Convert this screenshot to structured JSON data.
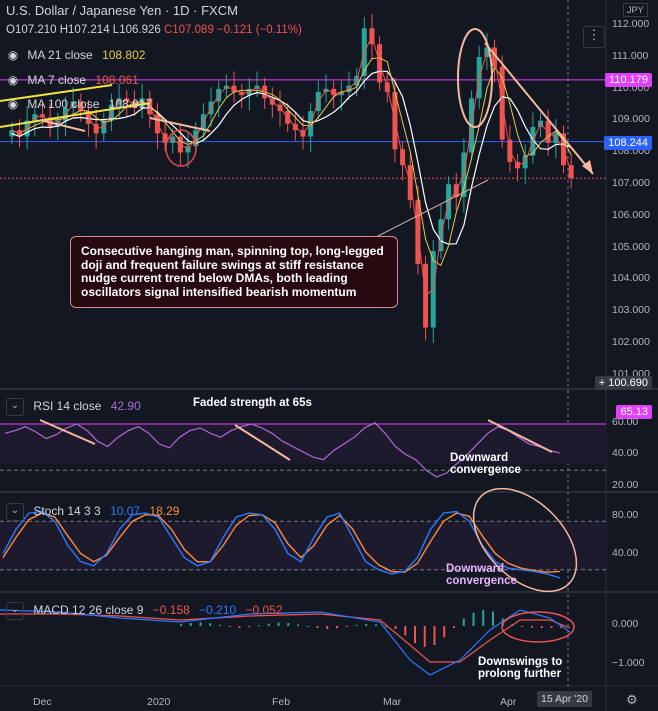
{
  "header": {
    "title": "U.S. Dollar / Japanese Yen · 1D · FXCM",
    "ohlc": {
      "o": "O107.210",
      "h": "H107.214",
      "l": "L106.926",
      "c": "C107.089",
      "chg": "−0.121 (−0.11%)"
    },
    "currency_badge": "JPY",
    "ma21": {
      "label": "MA 21 close",
      "value": "108.802",
      "color": "#e6c84a"
    },
    "ma7": {
      "label": "MA 7 close",
      "value": "108.061",
      "color": "#ef5350"
    },
    "ma100": {
      "label": "MA 100 close",
      "value": "108.917",
      "color": "#ffffff"
    }
  },
  "price_axis": {
    "ticks": [
      "112.000",
      "111.000",
      "110.000",
      "109.000",
      "108.000",
      "107.000",
      "106.000",
      "105.000",
      "104.000",
      "103.000",
      "102.000",
      "101.000"
    ],
    "tag_resistance": "110.179",
    "tag_current": "108.244",
    "tag_low": "100.690"
  },
  "rsi": {
    "label": "RSI 14 close",
    "value": "42.90",
    "tag": "65.13",
    "ticks": [
      "60.00",
      "40.00",
      "20.00"
    ],
    "color": "#b069d6"
  },
  "stoch": {
    "label": "Stoch 14 3 3",
    "k": "10.07",
    "d": "18.29",
    "ticks": [
      "80.00",
      "40.00"
    ],
    "k_color": "#2979ff",
    "d_color": "#ff8a3d"
  },
  "macd": {
    "label": "MACD 12 26 close 9",
    "v1": "−0.158",
    "v2": "−0.210",
    "v3": "−0.052",
    "ticks": [
      "0.000",
      "−1.000"
    ]
  },
  "time_axis": {
    "labels": [
      "Dec",
      "2020",
      "Feb",
      "Mar",
      "Apr"
    ],
    "current": "15 Apr '20"
  },
  "annotations": {
    "main": "Consecutive hanging man, spinning top, long-legged doji and frequent failure swings at stiff resistance nudge current trend below DMAs, both leading oscillators signal intensified bearish momentum",
    "rsi_faded": "Faded strength at 65s",
    "rsi_conv": "Downward convergence",
    "stoch_conv": "Downward convergence",
    "macd_note": "Downswings to prolong further"
  },
  "chart_data": {
    "type": "candlestick",
    "price_ylim": [
      101,
      112
    ],
    "ohlc_close_series": [
      108.6,
      108.4,
      108.9,
      109.1,
      109.0,
      108.7,
      108.9,
      109.3,
      109.5,
      109.2,
      108.8,
      108.5,
      108.9,
      109.4,
      109.6,
      109.5,
      109.3,
      109.6,
      109.1,
      108.5,
      108.2,
      108.4,
      107.9,
      108.1,
      108.6,
      109.1,
      109.5,
      109.9,
      110.0,
      109.8,
      109.7,
      109.9,
      110.0,
      109.6,
      109.4,
      109.2,
      108.8,
      108.6,
      108.4,
      109.2,
      109.8,
      109.9,
      109.7,
      109.8,
      110.0,
      110.3,
      111.8,
      111.3,
      110.1,
      109.8,
      108.0,
      107.5,
      106.4,
      104.4,
      102.4,
      104.8,
      105.8,
      106.9,
      106.5,
      107.9,
      109.6,
      110.9,
      111.2,
      110.6,
      108.3,
      107.6,
      107.4,
      107.8,
      108.7,
      108.9,
      108.2,
      108.5,
      107.5,
      107.1
    ],
    "rsi": [
      58,
      60,
      63,
      59,
      54,
      57,
      62,
      65,
      60,
      52,
      48,
      55,
      60,
      63,
      58,
      50,
      47,
      55,
      60,
      62,
      58,
      55,
      60,
      63,
      65,
      62,
      58,
      52,
      48,
      44,
      40,
      38,
      45,
      50,
      55,
      62,
      66,
      58,
      48,
      42,
      38,
      30,
      25,
      28,
      35,
      42,
      50,
      58,
      63,
      60,
      55,
      50,
      48,
      45,
      43
    ],
    "stoch_k": [
      40,
      70,
      90,
      92,
      80,
      50,
      30,
      25,
      40,
      70,
      88,
      90,
      85,
      60,
      35,
      25,
      30,
      60,
      85,
      90,
      88,
      70,
      40,
      30,
      60,
      85,
      90,
      60,
      30,
      20,
      15,
      18,
      35,
      70,
      90,
      92,
      80,
      50,
      30,
      22,
      20,
      18,
      15,
      10
    ],
    "stoch_d": [
      35,
      60,
      82,
      90,
      85,
      62,
      40,
      30,
      38,
      60,
      80,
      88,
      87,
      70,
      45,
      30,
      30,
      50,
      75,
      87,
      88,
      78,
      52,
      35,
      50,
      75,
      87,
      70,
      42,
      26,
      18,
      17,
      28,
      55,
      80,
      90,
      86,
      62,
      40,
      28,
      22,
      19,
      17,
      18
    ],
    "macd_hist": [
      0.05,
      0.08,
      0.1,
      0.07,
      0.03,
      -0.02,
      -0.05,
      -0.03,
      0.02,
      0.06,
      0.09,
      0.08,
      0.04,
      0.0,
      -0.05,
      -0.08,
      -0.06,
      -0.02,
      0.03,
      0.05,
      0.04,
      0.0,
      -0.08,
      -0.25,
      -0.45,
      -0.55,
      -0.5,
      -0.3,
      -0.05,
      0.2,
      0.35,
      0.42,
      0.38,
      0.2,
      0.05,
      -0.02,
      -0.04,
      -0.05,
      -0.05,
      -0.05
    ]
  }
}
